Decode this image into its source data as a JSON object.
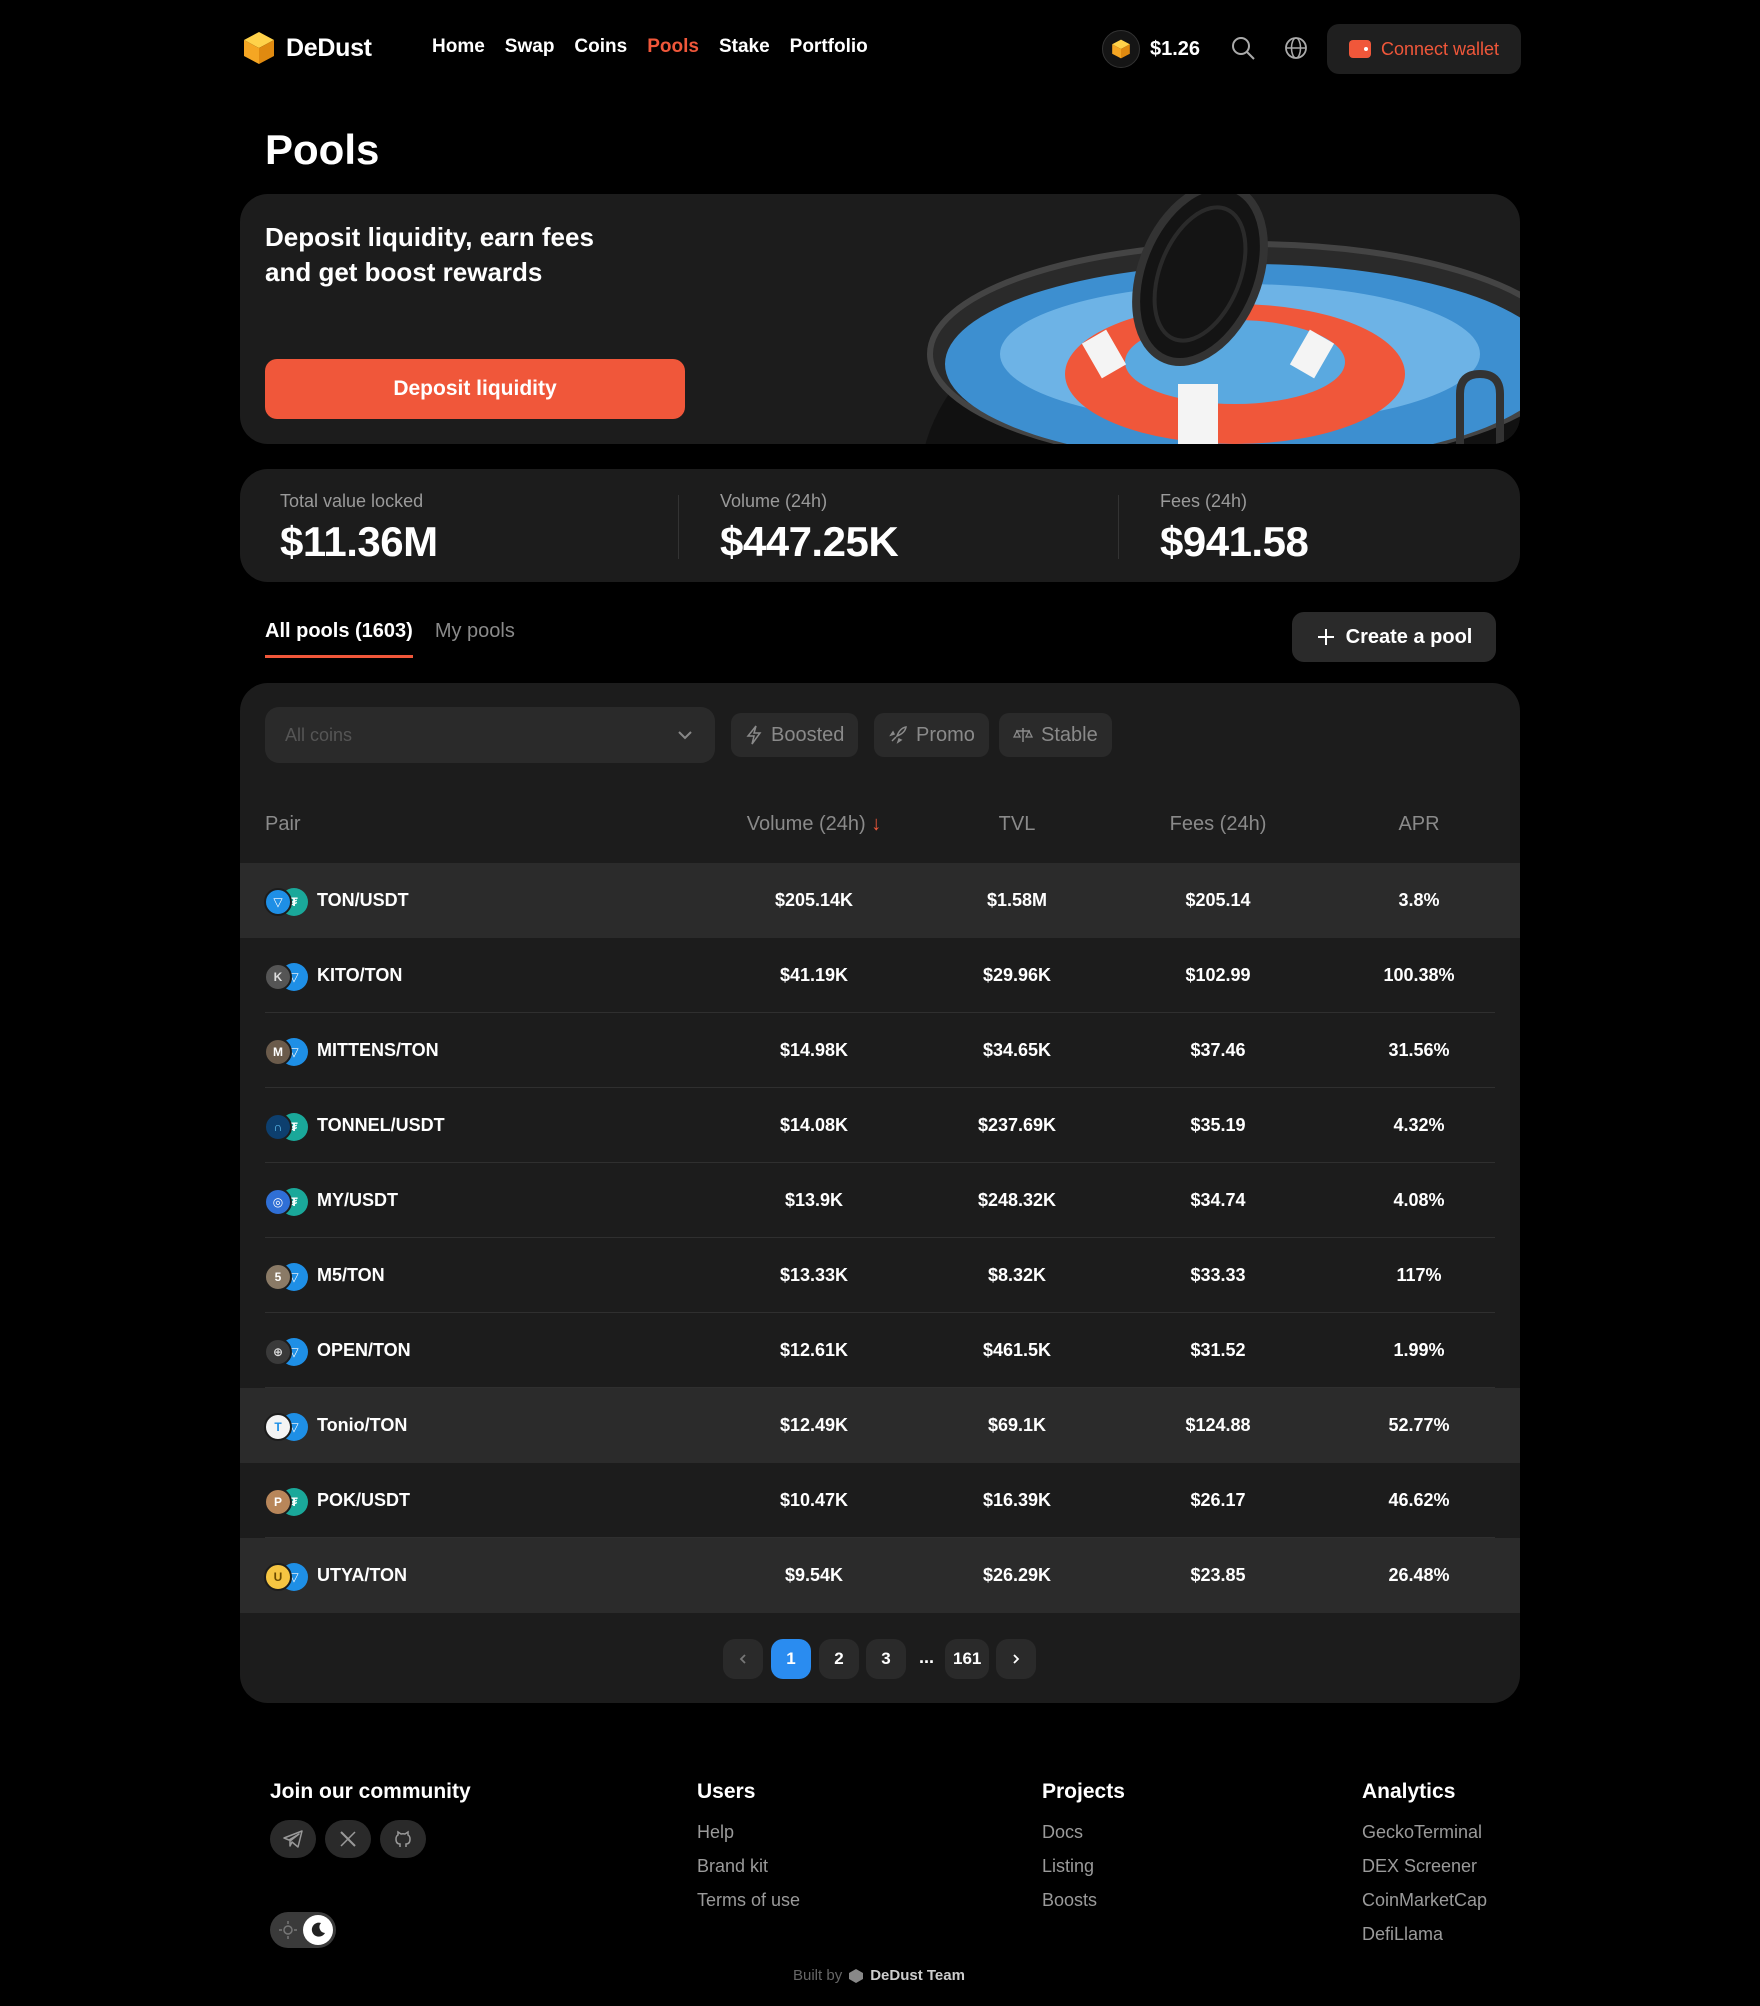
{
  "app": {
    "name": "DeDust",
    "nav": [
      "Home",
      "Swap",
      "Coins",
      "Pools",
      "Stake",
      "Portfolio"
    ],
    "active_nav": "Pools",
    "token_price": "$1.26",
    "connect_label": "Connect wallet"
  },
  "page": {
    "title": "Pools"
  },
  "hero": {
    "headline_line1": "Deposit liquidity, earn fees",
    "headline_line2": "and get boost rewards",
    "cta": "Deposit liquidity"
  },
  "stats": {
    "tvl_label": "Total value locked",
    "tvl": "$11.36M",
    "volume_label": "Volume (24h)",
    "volume": "$447.25K",
    "fees_label": "Fees (24h)",
    "fees": "$941.58"
  },
  "tabs": {
    "all": "All pools (1603)",
    "mine": "My pools",
    "create": "Create a pool"
  },
  "filters": {
    "coins_placeholder": "All coins",
    "chips": [
      "Boosted",
      "Promo",
      "Stable"
    ]
  },
  "table": {
    "headers": {
      "pair": "Pair",
      "volume": "Volume (24h)",
      "tvl": "TVL",
      "fees": "Fees (24h)",
      "apr": "APR"
    },
    "sort_indicator": "↓",
    "rows": [
      {
        "pair": "TON/USDT",
        "volume": "$205.14K",
        "tvl": "$1.58M",
        "fees": "$205.14",
        "apr": "3.8%",
        "icon1": "ton-icon",
        "icon2": "usdt-icon"
      },
      {
        "pair": "KITO/TON",
        "volume": "$41.19K",
        "tvl": "$29.96K",
        "fees": "$102.99",
        "apr": "100.38%",
        "icon1": "kito-icon",
        "icon2": "ton-icon"
      },
      {
        "pair": "MITTENS/TON",
        "volume": "$14.98K",
        "tvl": "$34.65K",
        "fees": "$37.46",
        "apr": "31.56%",
        "icon1": "mittens-icon",
        "icon2": "ton-icon"
      },
      {
        "pair": "TONNEL/USDT",
        "volume": "$14.08K",
        "tvl": "$237.69K",
        "fees": "$35.19",
        "apr": "4.32%",
        "icon1": "tonnel-icon",
        "icon2": "usdt-icon"
      },
      {
        "pair": "MY/USDT",
        "volume": "$13.9K",
        "tvl": "$248.32K",
        "fees": "$34.74",
        "apr": "4.08%",
        "icon1": "my-icon",
        "icon2": "usdt-icon"
      },
      {
        "pair": "M5/TON",
        "volume": "$13.33K",
        "tvl": "$8.32K",
        "fees": "$33.33",
        "apr": "117%",
        "icon1": "m5-icon",
        "icon2": "ton-icon"
      },
      {
        "pair": "OPEN/TON",
        "volume": "$12.61K",
        "tvl": "$461.5K",
        "fees": "$31.52",
        "apr": "1.99%",
        "icon1": "open-icon",
        "icon2": "ton-icon"
      },
      {
        "pair": "Tonio/TON",
        "volume": "$12.49K",
        "tvl": "$69.1K",
        "fees": "$124.88",
        "apr": "52.77%",
        "icon1": "tonio-icon",
        "icon2": "ton-icon"
      },
      {
        "pair": "POK/USDT",
        "volume": "$10.47K",
        "tvl": "$16.39K",
        "fees": "$26.17",
        "apr": "46.62%",
        "icon1": "pok-icon",
        "icon2": "usdt-icon"
      },
      {
        "pair": "UTYA/TON",
        "volume": "$9.54K",
        "tvl": "$26.29K",
        "fees": "$23.85",
        "apr": "26.48%",
        "icon1": "utya-icon",
        "icon2": "ton-icon"
      }
    ]
  },
  "pagination": {
    "pages": [
      "1",
      "2",
      "3"
    ],
    "ellipsis": "...",
    "last": "161",
    "current": "1"
  },
  "footer": {
    "community": "Join our community",
    "users": {
      "title": "Users",
      "links": [
        "Help",
        "Brand kit",
        "Terms of use"
      ]
    },
    "projects": {
      "title": "Projects",
      "links": [
        "Docs",
        "Listing",
        "Boosts"
      ]
    },
    "analytics": {
      "title": "Analytics",
      "links": [
        "GeckoTerminal",
        "DEX Screener",
        "CoinMarketCap",
        "DefiLlama"
      ]
    },
    "built_by": "Built by",
    "team": "DeDust Team"
  },
  "colors": {
    "accent": "#f0573a",
    "page_active": "#2a8cf0",
    "card": "#1c1c1c"
  }
}
